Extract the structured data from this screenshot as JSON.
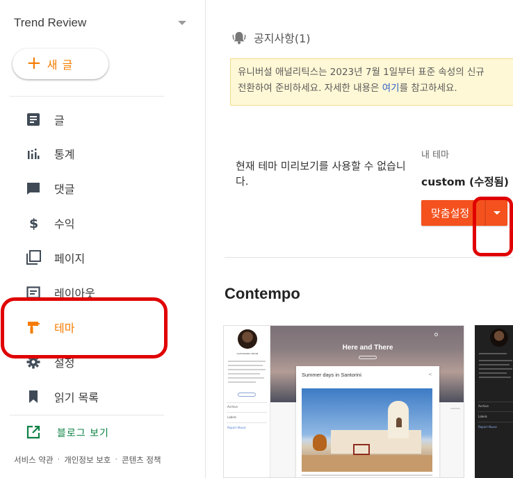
{
  "sidebar": {
    "blog_name": "Trend Review",
    "new_post_label": "새 글",
    "items": [
      {
        "label": "글",
        "icon": "posts-icon"
      },
      {
        "label": "통계",
        "icon": "stats-icon"
      },
      {
        "label": "댓글",
        "icon": "comments-icon"
      },
      {
        "label": "수익",
        "icon": "dollar-icon"
      },
      {
        "label": "페이지",
        "icon": "pages-icon"
      },
      {
        "label": "레이아웃",
        "icon": "layout-icon"
      },
      {
        "label": "테마",
        "icon": "theme-roller-icon"
      },
      {
        "label": "설정",
        "icon": "gear-icon"
      },
      {
        "label": "읽기 목록",
        "icon": "bookmark-icon"
      }
    ],
    "active_item": "테마",
    "view_blog_label": "블로그 보기",
    "footer": {
      "terms": "서비스 약관",
      "privacy": "개인정보 보호",
      "content_policy": "콘텐츠 정책",
      "separator": "·"
    }
  },
  "main": {
    "notice_title": "공지사항(1)",
    "notice_line1": "유니버설 애널리틱스는 2023년 7월 1일부터 표준 속성의 신규",
    "notice_line2_before": "전환하여 준비하세요. 자세한 내용은 ",
    "notice_link": "여기",
    "notice_line2_after": "를 참고하세요.",
    "preview_message": "현재 테마 미리보기를 사용할 수 없습니다.",
    "my_theme_label": "내 테마",
    "my_theme_name": "custom (수정됨)",
    "customize_button": "맞춤설정",
    "section_title": "Contempo"
  },
  "thumbnail": {
    "hero_title": "Here and There",
    "post_title": "Summer days in Santorini",
    "author": "ALEXANDRA BOHN",
    "menu_archive": "Archive",
    "menu_labels": "Labels",
    "report_abuse": "Report Abuse"
  },
  "colors": {
    "accent": "#f57c00",
    "button": "#f4511e",
    "highlight_ring": "#e00000",
    "view_blog": "#0b8043",
    "link": "#2b62c7",
    "notice_bg": "#fff8d6"
  }
}
